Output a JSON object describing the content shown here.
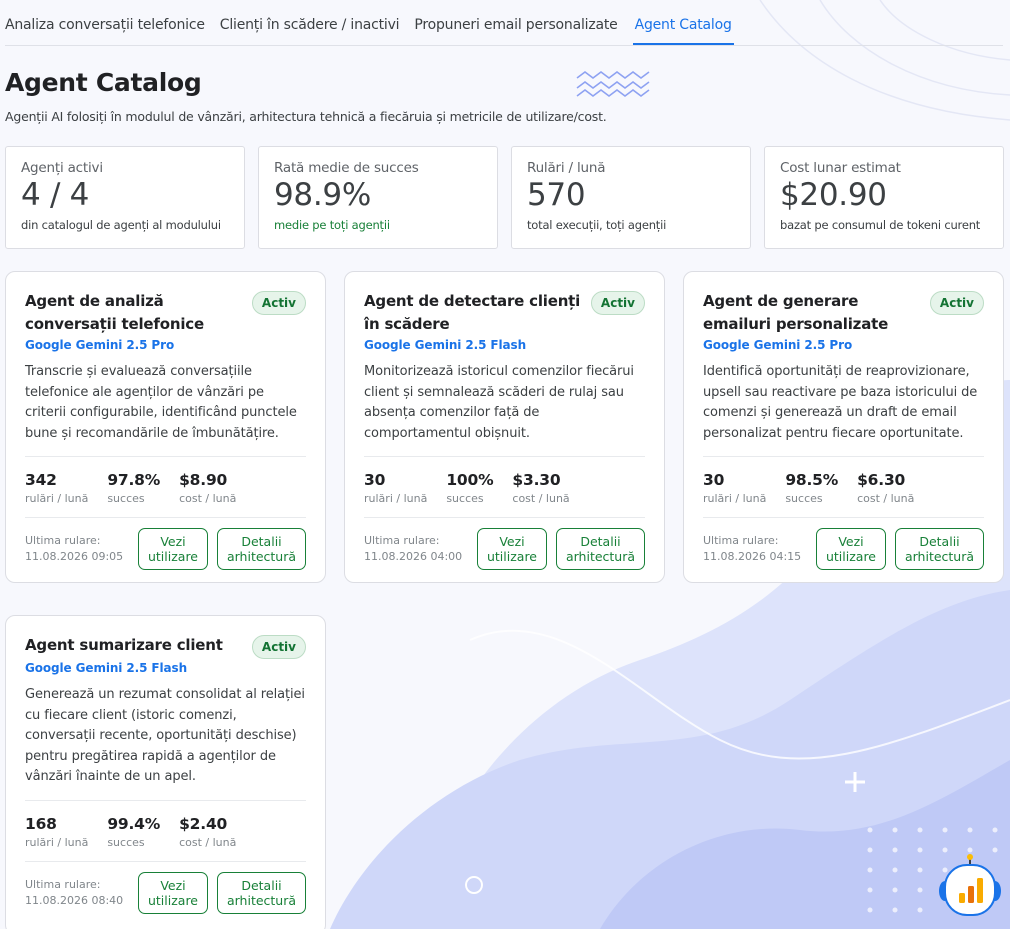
{
  "tabs": [
    {
      "label": "Analiza conversații telefonice"
    },
    {
      "label": "Clienți în scădere / inactivi"
    },
    {
      "label": "Propuneri email personalizate"
    },
    {
      "label": "Agent Catalog"
    }
  ],
  "page": {
    "title": "Agent Catalog",
    "subtitle": "Agenții AI folosiți în modulul de vânzări, arhitectura tehnică a fiecăruia și metricile de utilizare/cost."
  },
  "stats": [
    {
      "label": "Agenți activi",
      "value": "4 / 4",
      "note": "din catalogul de agenți al modulului"
    },
    {
      "label": "Rată medie de succes",
      "value": "98.9%",
      "note": "medie pe toți agenții"
    },
    {
      "label": "Rulări / lună",
      "value": "570",
      "note": "total execuții, toți agenții"
    },
    {
      "label": "Cost lunar estimat",
      "value": "$20.90",
      "note": "bazat pe consumul de tokeni curent"
    }
  ],
  "labels": {
    "status": "Activ",
    "runs": "rulări / lună",
    "success": "succes",
    "cost": "cost / lună",
    "last_run": "Ultima rulare:",
    "usage_button": "Vezi utilizare",
    "arch_button": "Detalii arhitectură"
  },
  "agents": [
    {
      "name": "Agent de analiză conversații telefonice",
      "model": "Google Gemini 2.5 Pro",
      "description": "Transcrie și evaluează conversațiile telefonice ale agenților de vânzări pe criterii configurabile, identificând punctele bune și recomandările de îmbunătățire.",
      "runs": "342",
      "success": "97.8%",
      "cost": "$8.90",
      "last_run": "11.08.2026 09:05"
    },
    {
      "name": "Agent de detectare clienți în scădere",
      "model": "Google Gemini 2.5 Flash",
      "description": "Monitorizează istoricul comenzilor fiecărui client și semnalează scăderi de rulaj sau absența comenzilor față de comportamentul obișnuit.",
      "runs": "30",
      "success": "100%",
      "cost": "$3.30",
      "last_run": "11.08.2026 04:00"
    },
    {
      "name": "Agent de generare emailuri personalizate",
      "model": "Google Gemini 2.5 Pro",
      "description": "Identifică oportunități de reaprovizionare, upsell sau reactivare pe baza istoricului de comenzi și generează un draft de email personalizat pentru fiecare oportunitate.",
      "runs": "30",
      "success": "98.5%",
      "cost": "$6.30",
      "last_run": "11.08.2026 04:15"
    },
    {
      "name": "Agent sumarizare client",
      "model": "Google Gemini 2.5 Flash",
      "description": "Generează un rezumat consolidat al relației cu fiecare client (istoric comenzi, conversații recente, oportunități deschise) pentru pregătirea rapidă a agenților de vânzări înainte de un apel.",
      "runs": "168",
      "success": "99.4%",
      "cost": "$2.40",
      "last_run": "11.08.2026 08:40"
    }
  ]
}
